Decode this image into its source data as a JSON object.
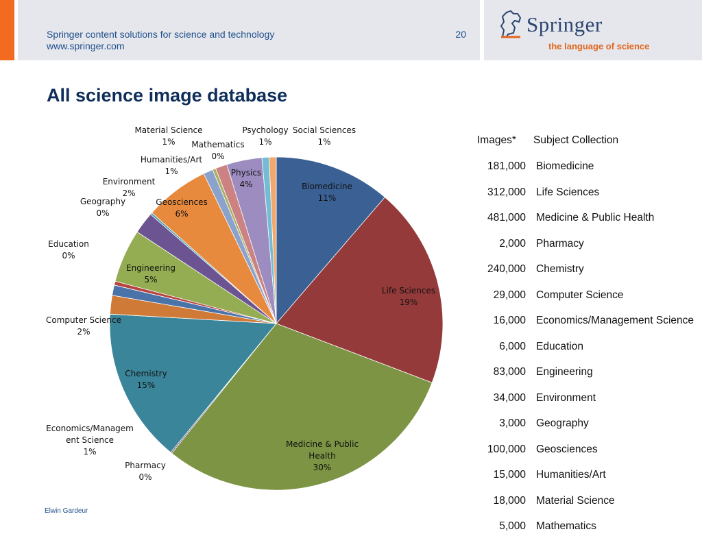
{
  "header": {
    "line1": "Springer content solutions for science and technology",
    "line2": "www.springer.com",
    "page_number": "20",
    "logo_text": "Springer",
    "logo_tagline": "the language of science"
  },
  "title": "All science image database",
  "footer": {
    "author": "Elwin Gardeur"
  },
  "table": {
    "header_images": "Images*",
    "header_subject": "Subject Collection",
    "rows": [
      {
        "images": "181,000",
        "subject": "Biomedicine"
      },
      {
        "images": "312,000",
        "subject": "Life Sciences"
      },
      {
        "images": "481,000",
        "subject": "Medicine & Public Health"
      },
      {
        "images": "2,000",
        "subject": "Pharmacy"
      },
      {
        "images": "240,000",
        "subject": "Chemistry"
      },
      {
        "images": "29,000",
        "subject": "Computer Science"
      },
      {
        "images": "16,000",
        "subject": "Economics/Management Science"
      },
      {
        "images": "6,000",
        "subject": "Education"
      },
      {
        "images": "83,000",
        "subject": "Engineering"
      },
      {
        "images": "34,000",
        "subject": "Environment"
      },
      {
        "images": "3,000",
        "subject": "Geography"
      },
      {
        "images": "100,000",
        "subject": "Geosciences"
      },
      {
        "images": "15,000",
        "subject": "Humanities/Art"
      },
      {
        "images": "18,000",
        "subject": "Material Science"
      },
      {
        "images": "5,000",
        "subject": "Mathematics"
      }
    ]
  },
  "chart_data": {
    "type": "pie",
    "slices": [
      {
        "label": "Biomedicine",
        "percent_label": "11%",
        "value": 181000,
        "color": "#3a6094"
      },
      {
        "label": "Life Sciences",
        "percent_label": "19%",
        "value": 312000,
        "color": "#943a3a"
      },
      {
        "label": "Medicine & Public Health",
        "percent_label": "30%",
        "value": 481000,
        "color": "#7c9443"
      },
      {
        "label": "Pharmacy",
        "percent_label": "0%",
        "value": 2000,
        "color": "#5e4a7e"
      },
      {
        "label": "Chemistry",
        "percent_label": "15%",
        "value": 240000,
        "color": "#3a8599"
      },
      {
        "label": "Computer Science",
        "percent_label": "2%",
        "value": 29000,
        "color": "#d07a37"
      },
      {
        "label": "Economics/Management Science",
        "percent_label": "1%",
        "value": 16000,
        "color": "#4a73aa"
      },
      {
        "label": "Education",
        "percent_label": "0%",
        "value": 6000,
        "color": "#b84442"
      },
      {
        "label": "Engineering",
        "percent_label": "5%",
        "value": 83000,
        "color": "#94ad52"
      },
      {
        "label": "Environment",
        "percent_label": "2%",
        "value": 34000,
        "color": "#6b5491"
      },
      {
        "label": "Geography",
        "percent_label": "0%",
        "value": 3000,
        "color": "#3d99b0"
      },
      {
        "label": "Geosciences",
        "percent_label": "6%",
        "value": 100000,
        "color": "#e88a3e"
      },
      {
        "label": "Humanities/Art",
        "percent_label": "1%",
        "value": 15000,
        "color": "#8aa2cc"
      },
      {
        "label": "Mathematics",
        "percent_label": "0%",
        "value": 5000,
        "color": "#aaaf64"
      },
      {
        "label": "Material Science",
        "percent_label": "1%",
        "value": 18000,
        "color": "#cc8282"
      },
      {
        "label": "Physics",
        "percent_label": "4%",
        "value": 55000,
        "color": "#9c8cbf"
      },
      {
        "label": "Psychology",
        "percent_label": "1%",
        "value": 11000,
        "color": "#74bcd6"
      },
      {
        "label": "Social Sciences",
        "percent_label": "1%",
        "value": 11000,
        "color": "#f0a86c"
      }
    ]
  }
}
